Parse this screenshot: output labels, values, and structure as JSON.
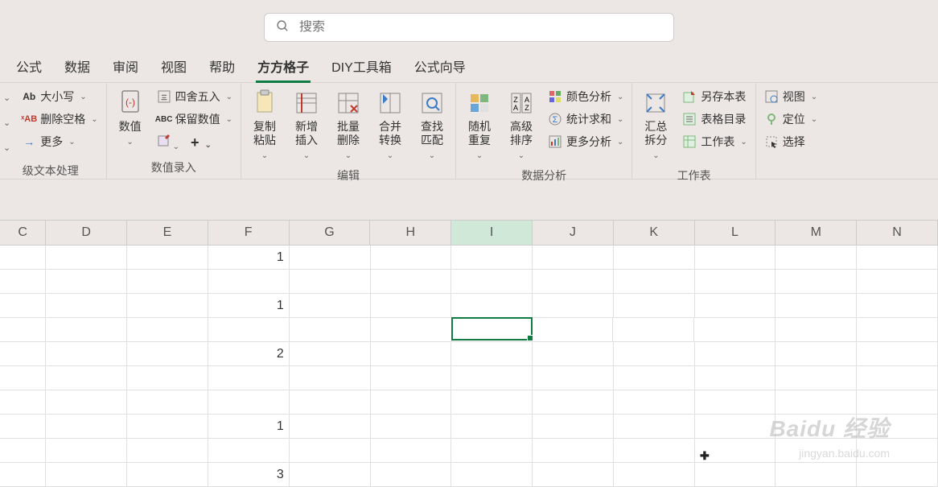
{
  "search": {
    "placeholder": "搜索"
  },
  "tabs": [
    "公式",
    "数据",
    "审阅",
    "视图",
    "帮助",
    "方方格子",
    "DIY工具箱",
    "公式向导"
  ],
  "active_tab": 5,
  "ribbon": {
    "text_group": {
      "label": "级文本处理",
      "items": [
        "大小写",
        "删除空格",
        "更多"
      ]
    },
    "value_group": {
      "label": "数值录入",
      "main": "数值",
      "items": [
        "四舍五入",
        "保留数值"
      ]
    },
    "edit_group": {
      "label": "编辑",
      "items": [
        "复制粘贴",
        "新增插入",
        "批量删除",
        "合并转换",
        "查找匹配"
      ]
    },
    "data_group": {
      "label": "数据分析",
      "big": [
        "随机重复",
        "高级排序"
      ],
      "items": [
        "颜色分析",
        "统计求和",
        "更多分析"
      ]
    },
    "ws_group": {
      "label": "工作表",
      "main": "汇总拆分",
      "items": [
        "另存本表",
        "表格目录",
        "工作表"
      ]
    },
    "view_group": {
      "items": [
        "视图",
        "定位",
        "选择"
      ]
    }
  },
  "columns": [
    "C",
    "D",
    "E",
    "F",
    "G",
    "H",
    "I",
    "J",
    "K",
    "L",
    "M",
    "N"
  ],
  "selected_col": "I",
  "rows": [
    {
      "F": "1"
    },
    {},
    {
      "F": "1"
    },
    {},
    {
      "F": "2"
    },
    {},
    {},
    {
      "F": "1"
    },
    {},
    {
      "F": "3"
    }
  ],
  "selected_cell": {
    "row": 3,
    "col": 6
  },
  "watermark": "Baidu 经验",
  "watermark_sub": "jingyan.baidu.com"
}
